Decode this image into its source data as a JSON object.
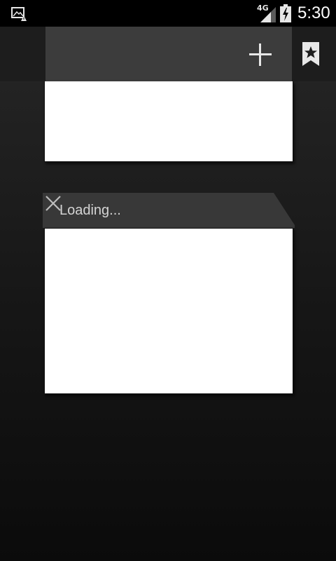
{
  "status_bar": {
    "network_type": "4G",
    "time": "5:30"
  },
  "toolbar": {
    "new_tab_icon": "plus-icon",
    "bookmarks_icon": "bookmark-star-icon"
  },
  "tabs": [
    {
      "title": ""
    },
    {
      "title": "Loading...",
      "close_icon": "close-icon"
    }
  ],
  "colors": {
    "status_bar": "#000000",
    "tab_header": "#3c3c3c",
    "tab_body": "#ffffff",
    "icon": "#e8e8e8"
  }
}
